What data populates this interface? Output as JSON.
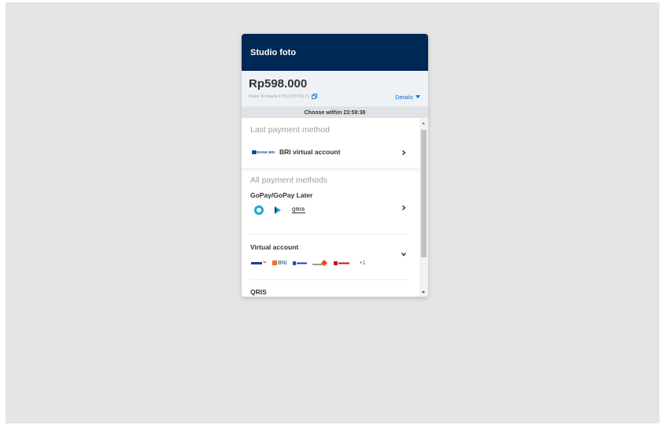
{
  "header": {
    "title": "Studio foto"
  },
  "summary": {
    "amount": "Rp598.000",
    "order_id": "Order ID #sufa-1731137679171",
    "details_label": "Details"
  },
  "timer": {
    "label": "Choose within 23:59:38"
  },
  "last_payment": {
    "title": "Last payment method",
    "method_label": "BRI virtual account",
    "logo_text": "BANK BRI"
  },
  "all_payments": {
    "title": "All payment methods",
    "methods": [
      {
        "label": "GoPay/GoPay Later",
        "logos": [
          "gopay-icon",
          "gopay-later-icon",
          "qris-icon"
        ]
      },
      {
        "label": "Virtual account",
        "logos": [
          "mandiri-logo",
          "bni-logo",
          "bri-logo",
          "permata-logo",
          "cimb-logo"
        ],
        "more": "+1"
      },
      {
        "label": "QRIS"
      }
    ],
    "logo_text": {
      "bni": "BNI",
      "qris": "QRIS"
    }
  },
  "colors": {
    "header_bg": "#002855",
    "accent": "#0b6fd1",
    "backdrop": "#e5e5e5"
  }
}
